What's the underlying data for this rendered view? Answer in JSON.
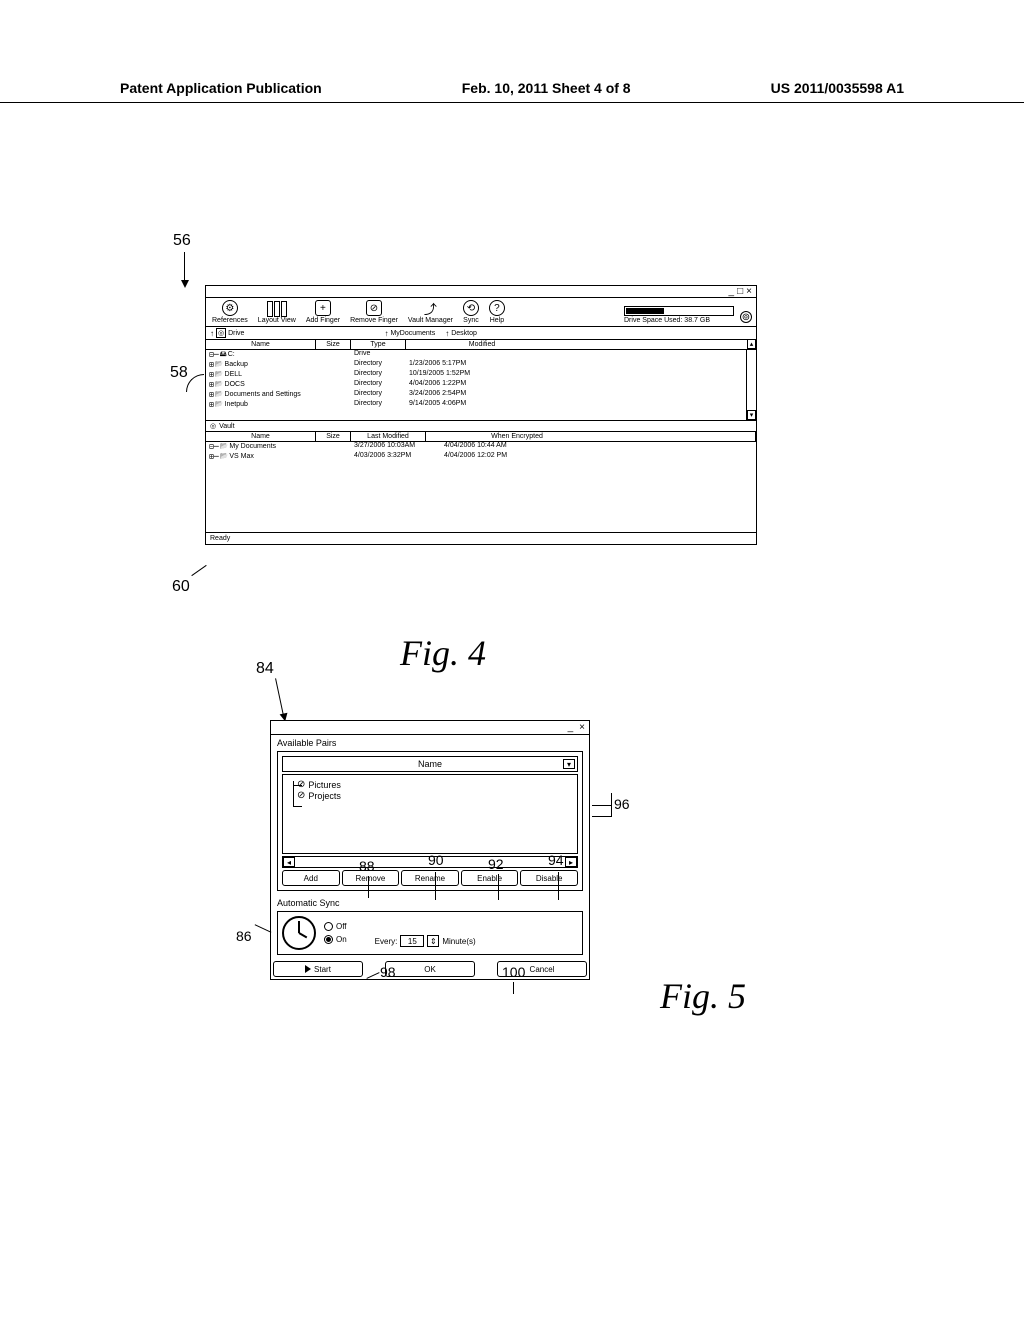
{
  "header": {
    "left": "Patent Application Publication",
    "center": "Feb. 10, 2011  Sheet 4 of 8",
    "right": "US 2011/0035598 A1"
  },
  "fig4": {
    "label": "Fig. 4",
    "callouts": {
      "c56": "56",
      "c58": "58",
      "c60": "60"
    },
    "window_controls": {
      "min": "_",
      "max": "□",
      "close": "×"
    },
    "toolbar": {
      "references": "References",
      "layout_view": "Layout View",
      "add_finger": "Add Finger",
      "remove_finger": "Remove Finger",
      "vault_manager": "Vault Manager",
      "sync": "Sync",
      "help": "Help",
      "drive_space": "Drive Space Used: 38.7 GB",
      "extra_icon": "⊚"
    },
    "locbar": {
      "drive": "Drive",
      "mydocs": "MyDocuments",
      "desktop": "Desktop"
    },
    "drive_panel": {
      "cols": {
        "name": "Name",
        "size": "Size",
        "type": "Type",
        "modified": "Modified"
      },
      "root": "C:",
      "rows": [
        {
          "name": "Backup",
          "type": "Directory",
          "mod": "1/23/2006  5:17PM"
        },
        {
          "name": "DELL",
          "type": "Directory",
          "mod": "10/19/2005  1:52PM"
        },
        {
          "name": "DOCS",
          "type": "Directory",
          "mod": "4/04/2006  1:22PM"
        },
        {
          "name": "Documents and Settings",
          "type": "Directory",
          "mod": "3/24/2006  2:54PM"
        },
        {
          "name": "Inetpub",
          "type": "Directory",
          "mod": "9/14/2005  4:06PM"
        }
      ],
      "root_type": "Drive"
    },
    "vault_panel": {
      "title": "Vault",
      "cols": {
        "name": "Name",
        "size": "Size",
        "last_modified": "Last Modified",
        "when_encrypted": "When Encrypted"
      },
      "rows": [
        {
          "name": "My Documents",
          "lm": "3/27/2006 10:03AM",
          "we": "4/04/2006 10:44 AM"
        },
        {
          "name": "VS Max",
          "lm": "4/03/2006 3:32PM",
          "we": "4/04/2006 12:02 PM"
        }
      ]
    },
    "status": "Ready"
  },
  "fig5": {
    "label": "Fig. 5",
    "callouts": {
      "c84": "84",
      "c86": "86",
      "c88": "88",
      "c90": "90",
      "c92": "92",
      "c94": "94",
      "c96": "96",
      "c98": "98",
      "c100": "100"
    },
    "window_controls": {
      "min": "_",
      "close": "×"
    },
    "available_pairs": "Available Pairs",
    "name_header": "Name",
    "tree": {
      "pictures": "Pictures",
      "projects": "Projects"
    },
    "buttons": {
      "add": "Add",
      "remove": "Remove",
      "rename": "Rename",
      "enable": "Enable",
      "disable": "Disable"
    },
    "autosync": {
      "title": "Automatic Sync",
      "off": "Off",
      "on": "On",
      "every": "Every:",
      "value": "15",
      "unit": "Minute(s)"
    },
    "bottom": {
      "start": "Start",
      "ok": "OK",
      "cancel": "Cancel"
    }
  }
}
